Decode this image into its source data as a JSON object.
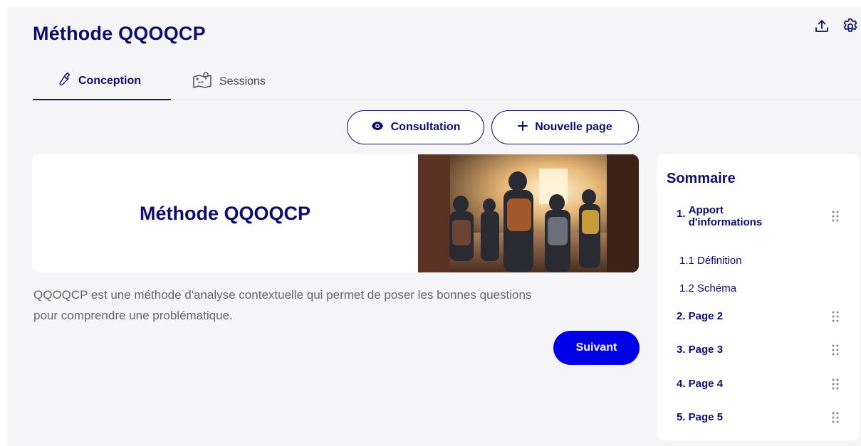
{
  "app": {
    "title": "Méthode QQOQCP"
  },
  "top_actions": [
    {
      "icon": "upload-icon"
    },
    {
      "icon": "gear-icon"
    }
  ],
  "tabs": [
    {
      "label": "Conception",
      "icon": "wrench-icon",
      "active": true
    },
    {
      "label": "Sessions",
      "icon": "map-icon",
      "active": false
    }
  ],
  "actions": {
    "consultation_label": "Consultation",
    "new_page_label": "Nouvelle page"
  },
  "page": {
    "hero_title": "Méthode QQOQCP",
    "hero_image_alt": "students-in-hallway",
    "description_line1": "QQOQCP est une méthode d'analyse contextuelle qui permet de poser les bonnes questions",
    "description_line2": "pour comprendre une problématique.",
    "next_label": "Suivant"
  },
  "summary": {
    "title": "Sommaire",
    "items": [
      {
        "number": "1.",
        "label_line1": "Apport",
        "label_line2": "d'informations"
      },
      {
        "label": "1.1 Définition"
      },
      {
        "label": "1.2 Schéma"
      },
      {
        "label": "2. Page 2"
      },
      {
        "label": "3. Page 3"
      },
      {
        "label": "4. Page 4"
      },
      {
        "label": "5. Page 5"
      }
    ]
  },
  "colors": {
    "primary": "#0d0d6b",
    "accent_button": "#0000e6",
    "background": "#f5f5f7"
  }
}
